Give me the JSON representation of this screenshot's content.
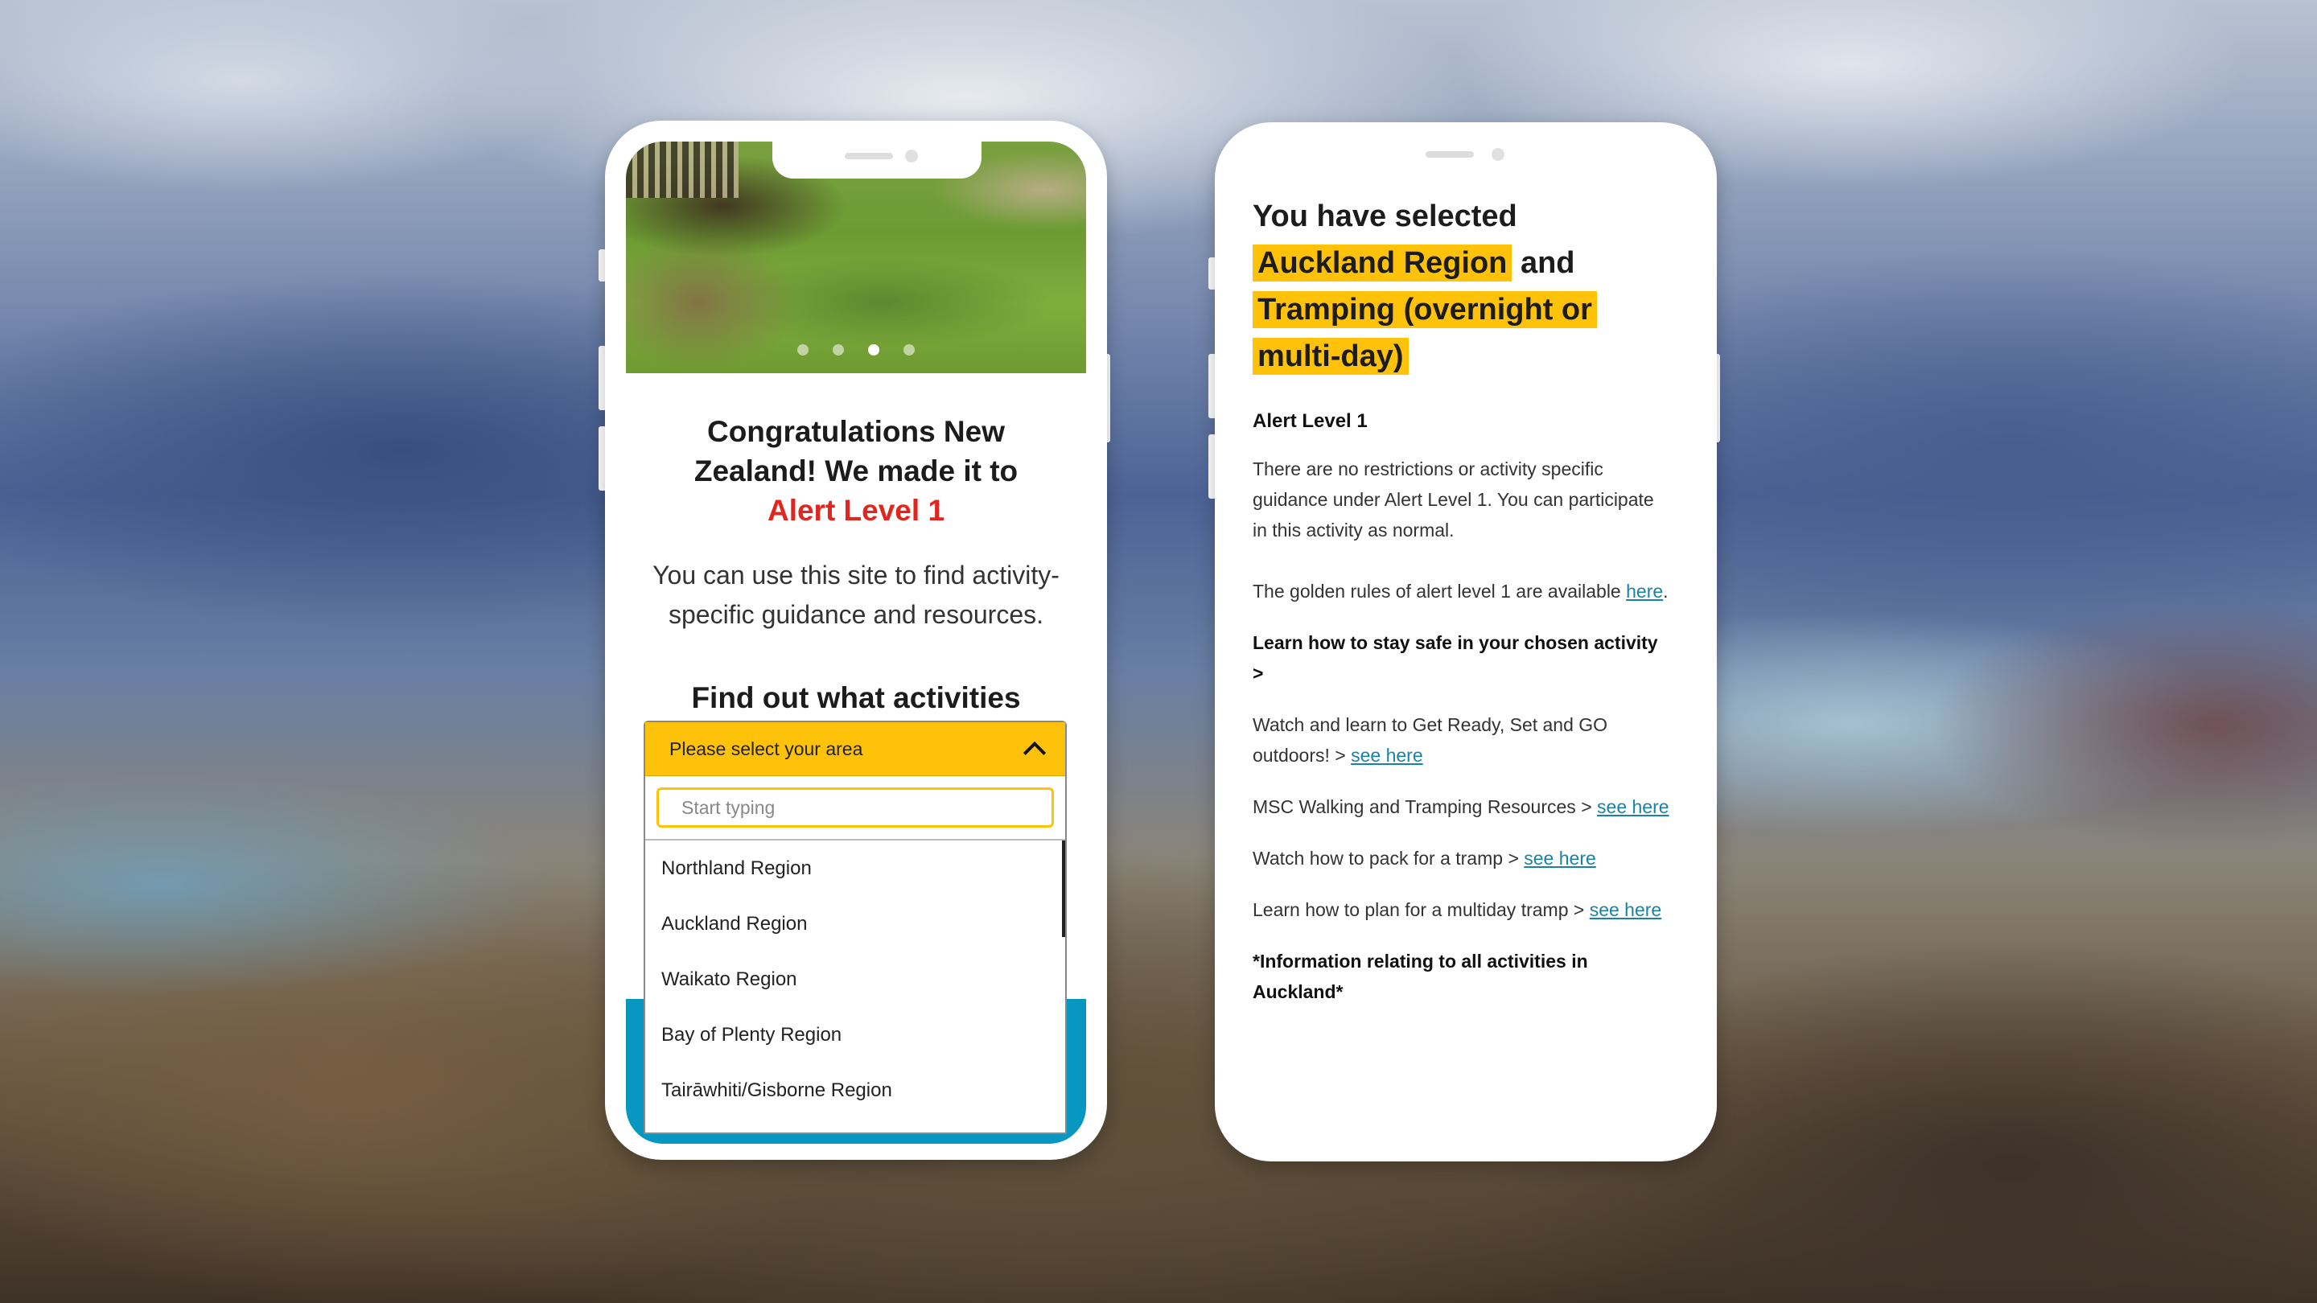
{
  "colors": {
    "accent_yellow": "#fec20b",
    "alert_red": "#e0261e",
    "link_teal": "#1a83a5",
    "band_teal": "#0797c0"
  },
  "left_phone": {
    "carousel": {
      "slide_count": 4,
      "active_index": 2
    },
    "heading_prefix": "Congratulations New Zealand! We made it to",
    "heading_highlight": "Alert Level 1",
    "intro": "You can use this site to find activity-specific guidance and resources.",
    "find_heading": "Find out what activities you can do using the search function below",
    "dropdown": {
      "label": "Please select your area",
      "expanded": true,
      "search_placeholder": "Start typing",
      "search_value": "",
      "options": [
        "Northland Region",
        "Auckland Region",
        "Waikato Region",
        "Bay of Plenty Region",
        "Tairāwhiti/Gisborne Region"
      ]
    }
  },
  "right_phone": {
    "title_prefix": "You have selected",
    "selected_region": "Auckland Region",
    "title_join": "and",
    "selected_activity": "Tramping (overnight or multi-day)",
    "alert_level": "Alert Level 1",
    "no_restrictions": "There are no restrictions or activity specific guidance under Alert Level 1. You can participate in this activity as normal.",
    "golden_rules": {
      "text": "The golden rules of alert level 1 are available",
      "link": "here",
      "suffix": "."
    },
    "learn_heading": "Learn how to stay safe in your chosen activity >",
    "resources": [
      {
        "text": "Watch and learn to Get Ready, Set and GO outdoors! >",
        "link": "see here"
      },
      {
        "text": "MSC Walking and Tramping Resources >",
        "link": "see here"
      },
      {
        "text": "Watch how to pack for a tramp >",
        "link": "see here"
      },
      {
        "text": "Learn how to plan for a multiday tramp >",
        "link": "see here"
      }
    ],
    "info_all": "*Information relating to all activities in Auckland*"
  }
}
